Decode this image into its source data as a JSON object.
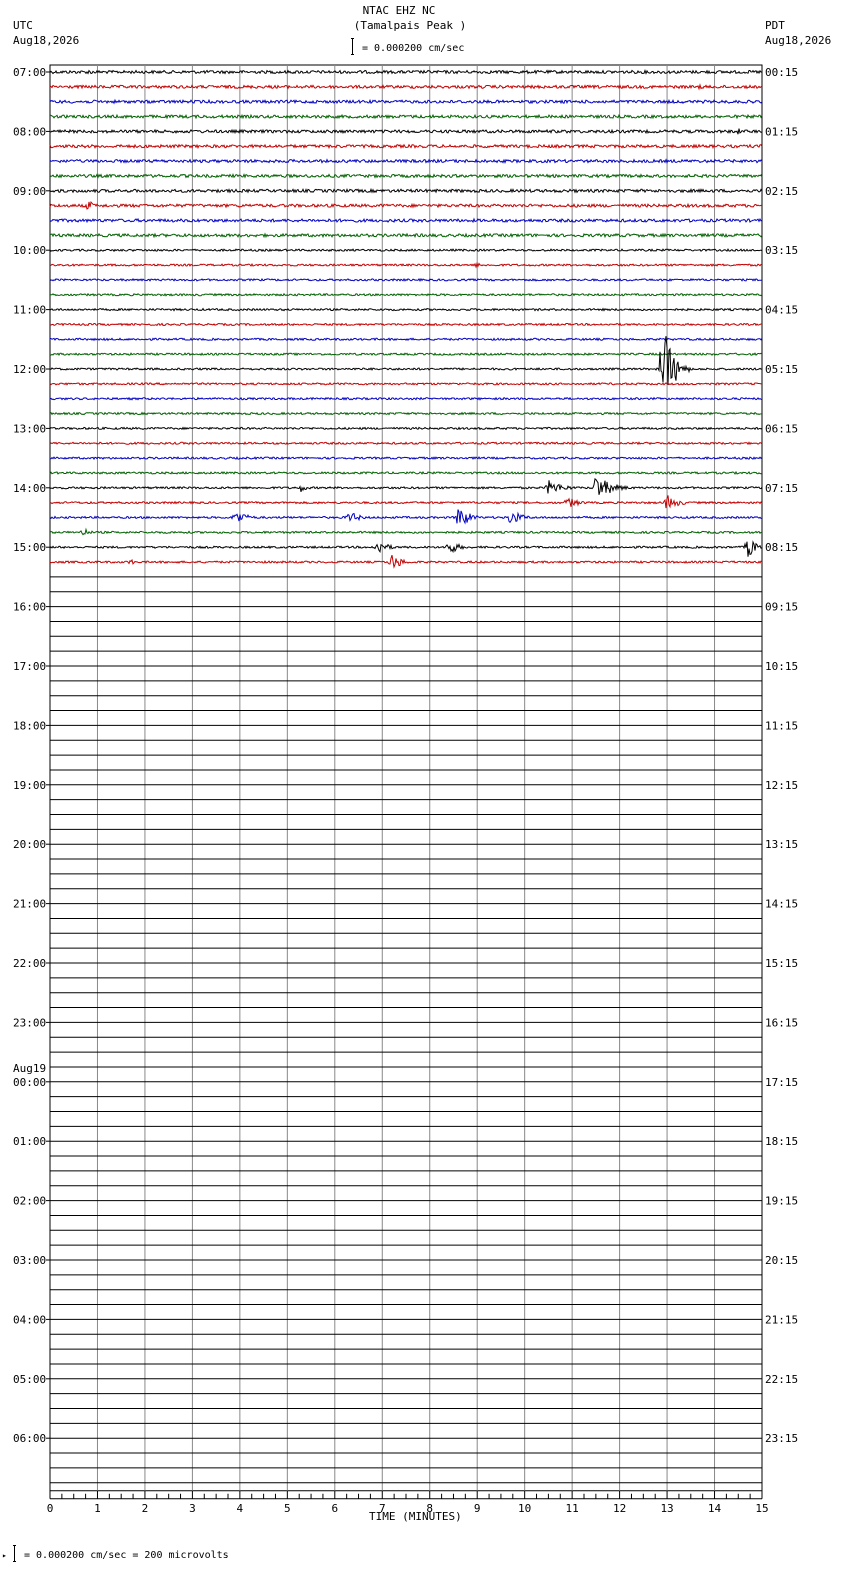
{
  "header": {
    "station": "NTAC EHZ NC",
    "site": "(Tamalpais Peak )",
    "scale_text": "= 0.000200 cm/sec",
    "left_tz": "UTC",
    "left_date": "Aug18,2026",
    "right_tz": "PDT",
    "right_date": "Aug18,2026"
  },
  "footer": {
    "scale_text": "= 0.000200 cm/sec =     200 microvolts"
  },
  "chart_data": {
    "type": "line",
    "xlabel": "TIME (MINUTES)",
    "xlim": [
      0,
      15
    ],
    "x_ticks": [
      "0",
      "1",
      "2",
      "3",
      "4",
      "5",
      "6",
      "7",
      "8",
      "9",
      "10",
      "11",
      "12",
      "13",
      "14",
      "15"
    ],
    "rows_per_hour": 4,
    "total_rows": 96,
    "traced_rows": 34,
    "trace_colors": [
      "#000000",
      "#c00000",
      "#0000c0",
      "#006000"
    ],
    "left_hour_labels": [
      {
        "row": 0,
        "label": "07:00"
      },
      {
        "row": 4,
        "label": "08:00"
      },
      {
        "row": 8,
        "label": "09:00"
      },
      {
        "row": 12,
        "label": "10:00"
      },
      {
        "row": 16,
        "label": "11:00"
      },
      {
        "row": 20,
        "label": "12:00"
      },
      {
        "row": 24,
        "label": "13:00"
      },
      {
        "row": 28,
        "label": "14:00"
      },
      {
        "row": 32,
        "label": "15:00"
      },
      {
        "row": 36,
        "label": "16:00"
      },
      {
        "row": 40,
        "label": "17:00"
      },
      {
        "row": 44,
        "label": "18:00"
      },
      {
        "row": 48,
        "label": "19:00"
      },
      {
        "row": 52,
        "label": "20:00"
      },
      {
        "row": 56,
        "label": "21:00"
      },
      {
        "row": 60,
        "label": "22:00"
      },
      {
        "row": 64,
        "label": "23:00"
      },
      {
        "row": 68,
        "label": "00:00",
        "date": "Aug19"
      },
      {
        "row": 72,
        "label": "01:00"
      },
      {
        "row": 76,
        "label": "02:00"
      },
      {
        "row": 80,
        "label": "03:00"
      },
      {
        "row": 84,
        "label": "04:00"
      },
      {
        "row": 88,
        "label": "05:00"
      },
      {
        "row": 92,
        "label": "06:00"
      }
    ],
    "right_hour_labels": [
      {
        "row": 0,
        "label": "00:15"
      },
      {
        "row": 4,
        "label": "01:15"
      },
      {
        "row": 8,
        "label": "02:15"
      },
      {
        "row": 12,
        "label": "03:15"
      },
      {
        "row": 16,
        "label": "04:15"
      },
      {
        "row": 20,
        "label": "05:15"
      },
      {
        "row": 24,
        "label": "06:15"
      },
      {
        "row": 28,
        "label": "07:15"
      },
      {
        "row": 32,
        "label": "08:15"
      },
      {
        "row": 36,
        "label": "09:15"
      },
      {
        "row": 40,
        "label": "10:15"
      },
      {
        "row": 44,
        "label": "11:15"
      },
      {
        "row": 48,
        "label": "12:15"
      },
      {
        "row": 52,
        "label": "13:15"
      },
      {
        "row": 56,
        "label": "14:15"
      },
      {
        "row": 60,
        "label": "15:15"
      },
      {
        "row": 64,
        "label": "16:15"
      },
      {
        "row": 68,
        "label": "17:15"
      },
      {
        "row": 72,
        "label": "18:15"
      },
      {
        "row": 76,
        "label": "19:15"
      },
      {
        "row": 80,
        "label": "20:15"
      },
      {
        "row": 84,
        "label": "21:15"
      },
      {
        "row": 88,
        "label": "22:15"
      },
      {
        "row": 92,
        "label": "23:15"
      }
    ],
    "events": [
      {
        "row": 0,
        "minute": 0.8,
        "amp": 3,
        "dur": 0.5
      },
      {
        "row": 1,
        "minute": 13.7,
        "amp": 3,
        "dur": 0.4
      },
      {
        "row": 4,
        "minute": 14.5,
        "amp": 4,
        "dur": 0.2
      },
      {
        "row": 9,
        "minute": 0.8,
        "amp": 6,
        "dur": 0.4
      },
      {
        "row": 13,
        "minute": 9.0,
        "amp": 3,
        "dur": 0.3
      },
      {
        "row": 20,
        "minute": 12.9,
        "amp": 50,
        "dur": 0.6
      },
      {
        "row": 28,
        "minute": 5.3,
        "amp": 5,
        "dur": 0.3
      },
      {
        "row": 28,
        "minute": 10.5,
        "amp": 8,
        "dur": 0.9
      },
      {
        "row": 28,
        "minute": 11.5,
        "amp": 14,
        "dur": 0.9
      },
      {
        "row": 29,
        "minute": 10.9,
        "amp": 6,
        "dur": 0.7
      },
      {
        "row": 29,
        "minute": 13.0,
        "amp": 8,
        "dur": 0.7
      },
      {
        "row": 30,
        "minute": 3.9,
        "amp": 8,
        "dur": 0.7
      },
      {
        "row": 30,
        "minute": 6.3,
        "amp": 7,
        "dur": 0.6
      },
      {
        "row": 30,
        "minute": 8.6,
        "amp": 14,
        "dur": 0.6
      },
      {
        "row": 30,
        "minute": 9.7,
        "amp": 8,
        "dur": 0.7
      },
      {
        "row": 31,
        "minute": 0.7,
        "amp": 5,
        "dur": 0.4
      },
      {
        "row": 32,
        "minute": 6.9,
        "amp": 8,
        "dur": 0.6
      },
      {
        "row": 32,
        "minute": 8.4,
        "amp": 8,
        "dur": 0.6
      },
      {
        "row": 32,
        "minute": 14.7,
        "amp": 12,
        "dur": 0.5
      },
      {
        "row": 33,
        "minute": 7.2,
        "amp": 9,
        "dur": 0.6
      },
      {
        "row": 33,
        "minute": 1.7,
        "amp": 4,
        "dur": 0.2
      }
    ]
  }
}
